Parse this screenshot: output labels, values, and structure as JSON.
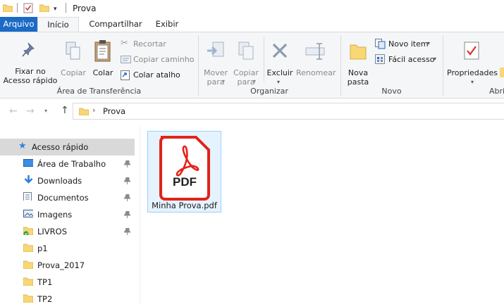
{
  "window": {
    "title": "Prova"
  },
  "tabs": [
    {
      "label": "Arquivo"
    },
    {
      "label": "Início"
    },
    {
      "label": "Compartilhar"
    },
    {
      "label": "Exibir"
    }
  ],
  "ribbon": {
    "clipboard": {
      "fixar_line1": "Fixar no",
      "fixar_line2": "Acesso rápido",
      "copiar": "Copiar",
      "colar": "Colar",
      "recortar": "Recortar",
      "copiar_caminho": "Copiar caminho",
      "colar_atalho": "Colar atalho",
      "group_label": "Área de Transferência"
    },
    "organize": {
      "mover_line1": "Mover",
      "mover_line2": "para",
      "copiar_line1": "Copiar",
      "copiar_line2": "para",
      "excluir": "Excluir",
      "renomear": "Renomear",
      "group_label": "Organizar"
    },
    "novo": {
      "nova_line1": "Nova",
      "nova_line2": "pasta",
      "novo_item": "Novo item",
      "facil_acesso": "Fácil acesso",
      "group_label": "Novo"
    },
    "abrir": {
      "propriedades": "Propriedades",
      "group_label": "Abri"
    }
  },
  "address": {
    "path": "Prova"
  },
  "sidebar": {
    "items": [
      {
        "label": "Acesso rápido",
        "icon": "star-icon"
      },
      {
        "label": "Área de Trabalho",
        "icon": "desktop-icon"
      },
      {
        "label": "Downloads",
        "icon": "download-icon"
      },
      {
        "label": "Documentos",
        "icon": "document-icon"
      },
      {
        "label": "Imagens",
        "icon": "image-icon"
      },
      {
        "label": "LIVROS",
        "icon": "folder-icon"
      },
      {
        "label": "p1",
        "icon": "folder-icon"
      },
      {
        "label": "Prova_2017",
        "icon": "folder-icon"
      },
      {
        "label": "TP1",
        "icon": "folder-icon"
      },
      {
        "label": "TP2",
        "icon": "folder-icon"
      }
    ]
  },
  "files": [
    {
      "name": "Minha Prova.pdf",
      "badge": "PDF"
    }
  ],
  "colors": {
    "accent": "#1b6ac6",
    "pdf_red": "#e2231a",
    "folder": "#f8d775"
  }
}
